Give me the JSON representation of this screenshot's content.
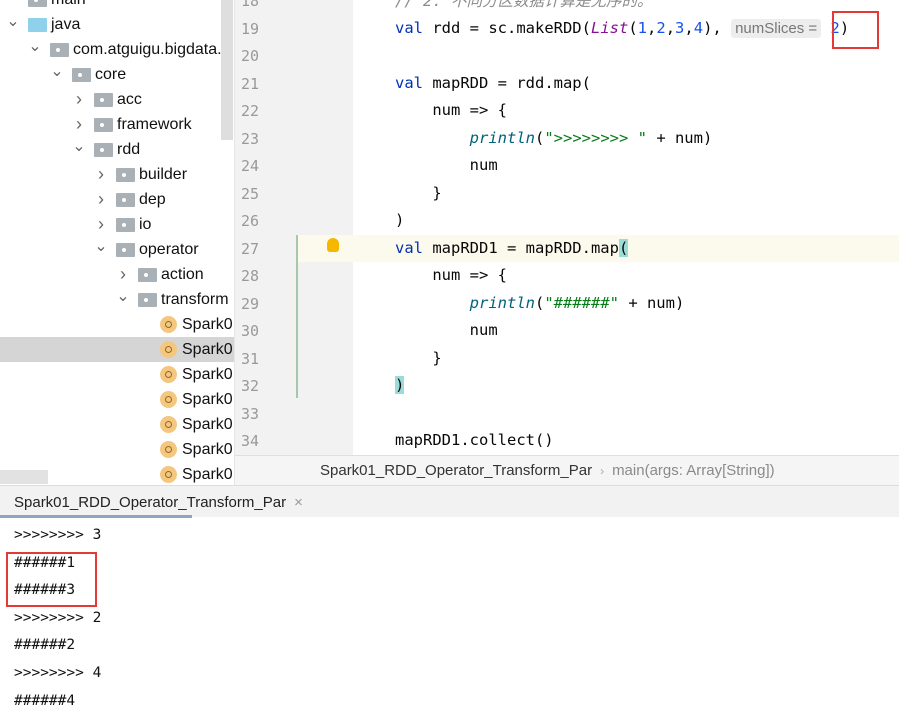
{
  "tree": [
    {
      "label": "main",
      "indent": 0,
      "arrow": "",
      "icon": "folder",
      "sel": false
    },
    {
      "label": "java",
      "indent": 0,
      "arrow": "v",
      "icon": "folder-blue",
      "sel": false
    },
    {
      "label": "com.atguigu.bigdata.s",
      "indent": 1,
      "arrow": "v",
      "icon": "folder",
      "sel": false
    },
    {
      "label": "core",
      "indent": 2,
      "arrow": "v",
      "icon": "folder",
      "sel": false
    },
    {
      "label": "acc",
      "indent": 3,
      "arrow": ">",
      "icon": "folder",
      "sel": false
    },
    {
      "label": "framework",
      "indent": 3,
      "arrow": ">",
      "icon": "folder",
      "sel": false
    },
    {
      "label": "rdd",
      "indent": 3,
      "arrow": "v",
      "icon": "folder",
      "sel": false
    },
    {
      "label": "builder",
      "indent": 4,
      "arrow": ">",
      "icon": "folder",
      "sel": false
    },
    {
      "label": "dep",
      "indent": 4,
      "arrow": ">",
      "icon": "folder",
      "sel": false
    },
    {
      "label": "io",
      "indent": 4,
      "arrow": ">",
      "icon": "folder",
      "sel": false
    },
    {
      "label": "operator",
      "indent": 4,
      "arrow": "v",
      "icon": "folder",
      "sel": false
    },
    {
      "label": "action",
      "indent": 5,
      "arrow": ">",
      "icon": "folder",
      "sel": false
    },
    {
      "label": "transform",
      "indent": 5,
      "arrow": "v",
      "icon": "folder",
      "sel": false
    },
    {
      "label": "Spark0",
      "indent": 6,
      "arrow": "",
      "icon": "class",
      "sel": false
    },
    {
      "label": "Spark0",
      "indent": 6,
      "arrow": "",
      "icon": "class",
      "sel": true
    },
    {
      "label": "Spark0",
      "indent": 6,
      "arrow": "",
      "icon": "class",
      "sel": false
    },
    {
      "label": "Spark0",
      "indent": 6,
      "arrow": "",
      "icon": "class",
      "sel": false
    },
    {
      "label": "Spark0",
      "indent": 6,
      "arrow": "",
      "icon": "class",
      "sel": false
    },
    {
      "label": "Spark0",
      "indent": 6,
      "arrow": "",
      "icon": "class",
      "sel": false
    },
    {
      "label": "Spark0",
      "indent": 6,
      "arrow": "",
      "icon": "class",
      "sel": false
    }
  ],
  "line_numbers": [
    "18",
    "19",
    "20",
    "21",
    "22",
    "23",
    "24",
    "25",
    "26",
    "27",
    "28",
    "29",
    "30",
    "31",
    "32",
    "33",
    "34"
  ],
  "code": {
    "l18": "// 2. 不同分区数据计算是无序的。",
    "l19a": "val",
    "l19b": " rdd = sc.makeRDD(",
    "l19c": "List",
    "l19d": "(",
    "n1": "1",
    "n2": "2",
    "n3": "3",
    "n4": "4",
    "l19e": "), ",
    "hint": "numSlices =",
    "n5": "2",
    "l19f": ")",
    "l21a": "val",
    "l21b": " mapRDD = rdd.map(",
    "l22": "    num => {",
    "l23a": "println",
    "l23b": "(",
    "l23c": "\">>>>>>>> \"",
    "l23d": " + num)",
    "l24": "        num",
    "l25": "    }",
    "l26": ")",
    "l27a": "val",
    "l27b": " mapRDD1 = mapRDD.map",
    "l27c": "(",
    "l28": "    num => {",
    "l29a": "println",
    "l29b": "(",
    "l29c": "\"######\"",
    "l29d": " + num)",
    "l30": "        num",
    "l31": "    }",
    "l32": ")",
    "l34": "mapRDD1.collect()"
  },
  "breadcrumb": {
    "file": "Spark01_RDD_Operator_Transform_Par",
    "method": "main(args: Array[String])"
  },
  "console_tab": {
    "label": "Spark01_RDD_Operator_Transform_Par",
    "close": "×"
  },
  "output": [
    ">>>>>>>> 3",
    "######1",
    "######3",
    ">>>>>>>> 2",
    "######2",
    ">>>>>>>> 4",
    "######4"
  ],
  "colors": {
    "highlight_box": "#e53935",
    "keyword": "#0033b3",
    "number": "#1750eb",
    "string": "#067d17"
  }
}
